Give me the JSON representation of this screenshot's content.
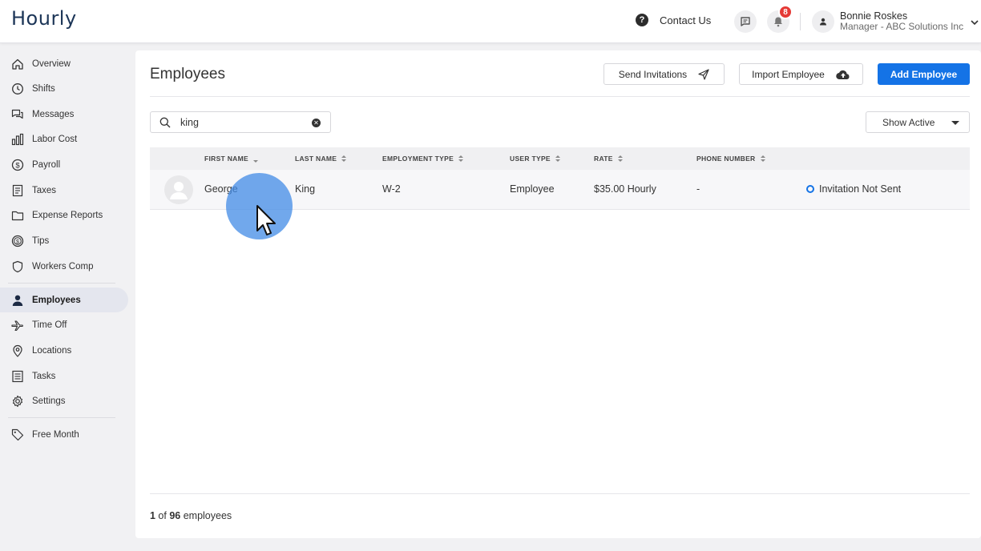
{
  "header": {
    "logo": "Hourly",
    "contact_label": "Contact Us",
    "notification_count": "8",
    "user_name": "Bonnie Roskes",
    "user_role": "Manager - ABC Solutions Inc"
  },
  "sidebar": {
    "items": [
      {
        "label": "Overview",
        "icon": "home-icon"
      },
      {
        "label": "Shifts",
        "icon": "clock-icon"
      },
      {
        "label": "Messages",
        "icon": "chat-icon"
      },
      {
        "label": "Labor Cost",
        "icon": "bar-chart-icon"
      },
      {
        "label": "Payroll",
        "icon": "dollar-circle-icon"
      },
      {
        "label": "Taxes",
        "icon": "document-icon"
      },
      {
        "label": "Expense Reports",
        "icon": "folder-icon"
      },
      {
        "label": "Tips",
        "icon": "coin-icon"
      },
      {
        "label": "Workers Comp",
        "icon": "shield-icon"
      },
      {
        "label": "Employees",
        "icon": "person-icon",
        "active": true
      },
      {
        "label": "Time Off",
        "icon": "plane-icon"
      },
      {
        "label": "Locations",
        "icon": "pin-icon"
      },
      {
        "label": "Tasks",
        "icon": "list-icon"
      },
      {
        "label": "Settings",
        "icon": "gear-icon"
      },
      {
        "label": "Free Month",
        "icon": "tag-icon"
      }
    ]
  },
  "main": {
    "title": "Employees",
    "send_invitations": "Send Invitations",
    "import_employee": "Import Employee",
    "add_employee": "Add Employee",
    "search_value": "king",
    "filter_label": "Show Active",
    "columns": [
      "FIRST NAME",
      "LAST NAME",
      "EMPLOYMENT TYPE",
      "USER TYPE",
      "RATE",
      "PHONE NUMBER"
    ],
    "rows": [
      {
        "first_name": "George",
        "last_name": "King",
        "employment_type": "W-2",
        "user_type": "Employee",
        "rate": "$35.00 Hourly",
        "phone": "-",
        "status": "Invitation Not Sent"
      }
    ],
    "count_current": "1",
    "count_of": " of ",
    "count_total": "96",
    "count_suffix": " employees"
  },
  "colors": {
    "accent": "#1473e6",
    "badge": "#e53935",
    "brand": "#1c3557"
  }
}
